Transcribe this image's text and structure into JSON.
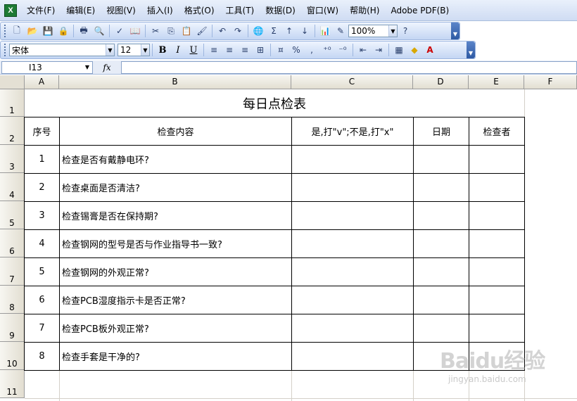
{
  "menubar": {
    "items": [
      "文件(F)",
      "编辑(E)",
      "视图(V)",
      "插入(I)",
      "格式(O)",
      "工具(T)",
      "数据(D)",
      "窗口(W)",
      "帮助(H)",
      "Adobe PDF(B)"
    ]
  },
  "toolbar": {
    "zoom": "100%",
    "sum_symbol": "Σ"
  },
  "format": {
    "font_name": "宋体",
    "font_size": "12",
    "bold": "B",
    "italic": "I",
    "underline": "U",
    "percent": "%",
    "comma": ","
  },
  "formula_bar": {
    "name_box": "I13",
    "fx": "fx",
    "value": ""
  },
  "sheet": {
    "columns": [
      "A",
      "B",
      "C",
      "D",
      "E",
      "F"
    ],
    "rows": [
      "1",
      "2",
      "3",
      "4",
      "5",
      "6",
      "7",
      "8",
      "9",
      "10",
      "11"
    ],
    "title": "每日点检表",
    "headers": [
      "序号",
      "检查内容",
      "是,打\"v\";不是,打\"x\"",
      "日期",
      "检查者"
    ],
    "items": [
      {
        "no": "1",
        "content": "检查是否有戴静电环?"
      },
      {
        "no": "2",
        "content": "检查桌面是否清洁?"
      },
      {
        "no": "3",
        "content": "检查锡膏是否在保持期?"
      },
      {
        "no": "4",
        "content": "检查钢网的型号是否与作业指导书一致?"
      },
      {
        "no": "5",
        "content": "检查钢网的外观正常?"
      },
      {
        "no": "6",
        "content": "检查PCB湿度指示卡是否正常?"
      },
      {
        "no": "7",
        "content": "检查PCB板外观正常?"
      },
      {
        "no": "8",
        "content": "检查手套是干净的?"
      }
    ]
  },
  "watermark": {
    "brand": "Baidu经验",
    "url": "jingyan.baidu.com"
  }
}
